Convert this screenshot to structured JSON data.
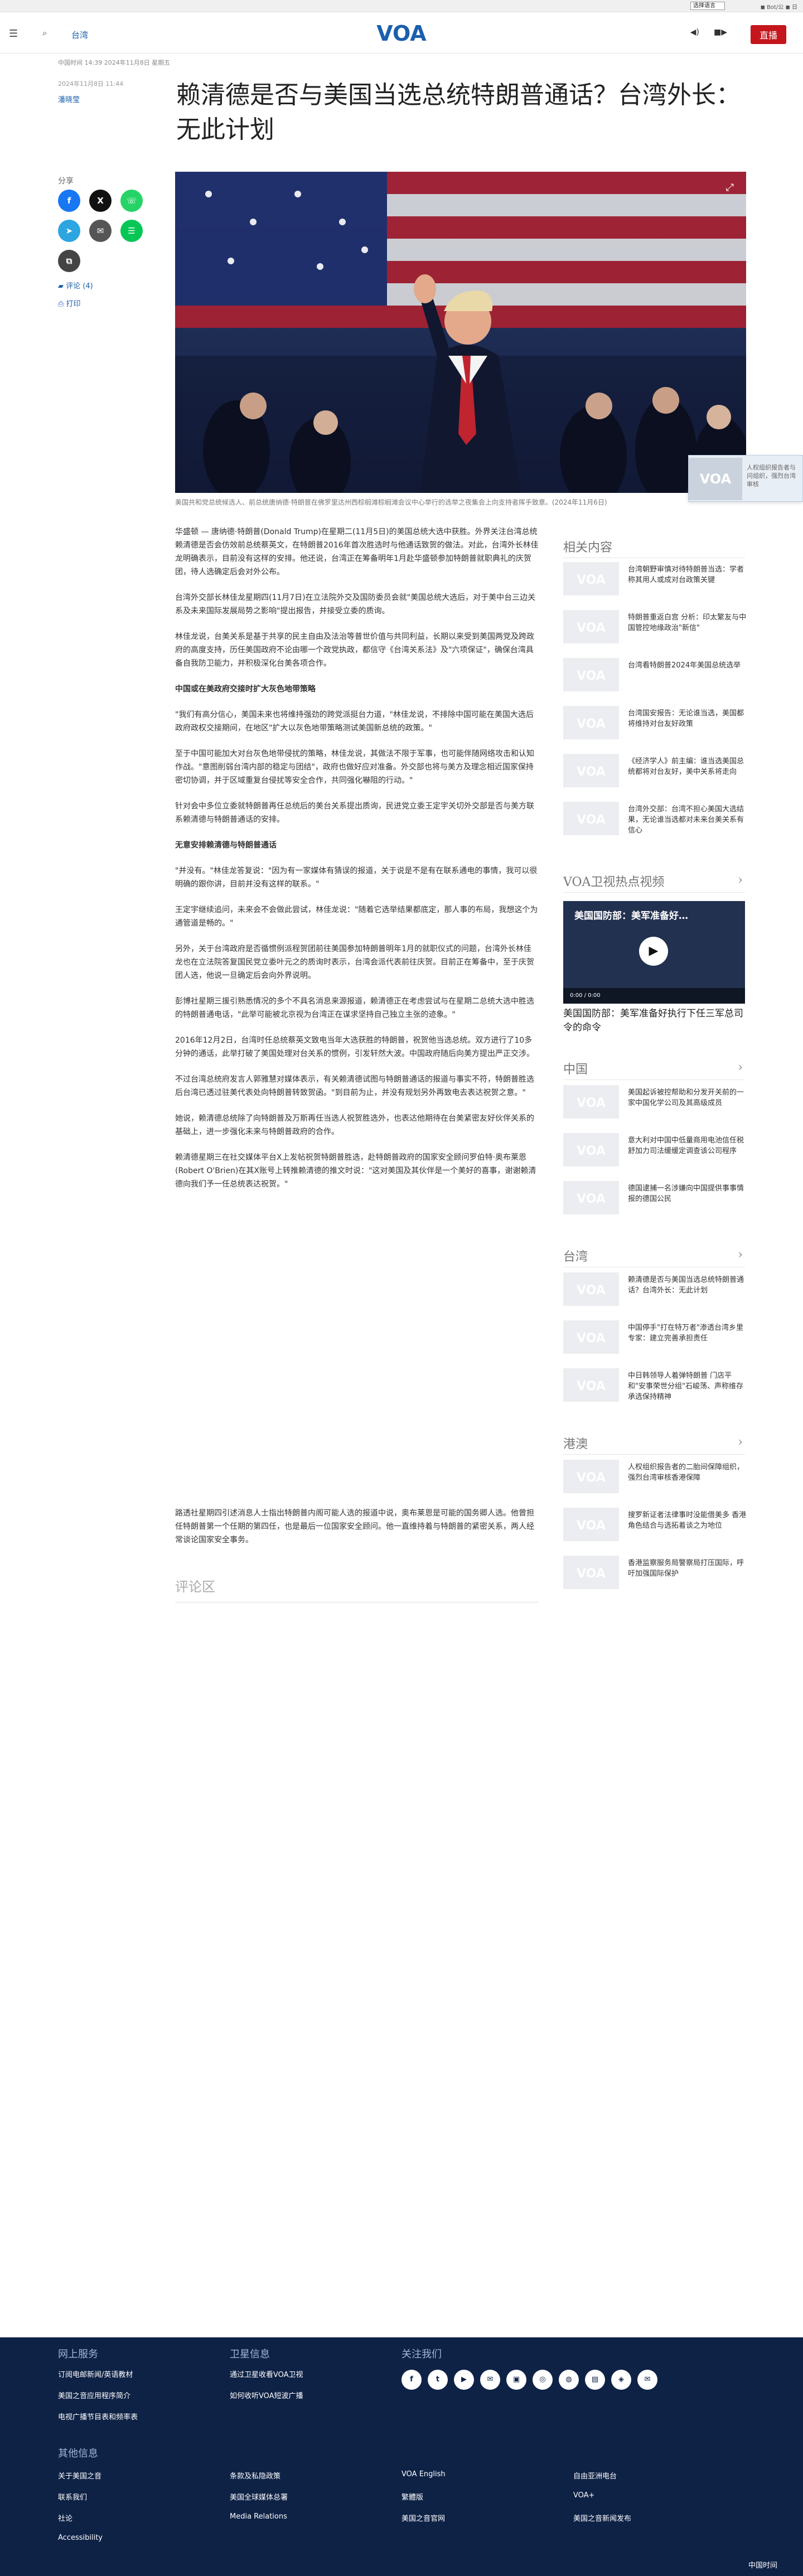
{
  "topbar": {
    "language_select": "选择语言",
    "links": "◼ Bot/公 ◼ 日"
  },
  "header": {
    "section": "台湾",
    "live_label": "直播"
  },
  "article": {
    "dateline": "中国时间 14:39 2024年11月8日 星期五",
    "published": "2024年11月8日 11:44",
    "author": "潘晓莹",
    "title": "赖清德是否与美国当选总统特朗普通话？台湾外长：无此计划",
    "share_label": "分享",
    "comments": "评论 (4)",
    "print": "打印",
    "caption": "美国共和党总统候选人、前总统唐纳德·特朗普在佛罗里达州西棕榈滩棕榈滩会议中心举行的选举之夜集会上向支持者挥手致意。(2024年11月6日)",
    "paragraphs": [
      {
        "type": "p",
        "text": "华盛顿 — 唐纳德·特朗普(Donald Trump)在星期二(11月5日)的美国总统大选中获胜。外界关注台湾总统赖清德是否会仿效前总统蔡英文，在特朗普2016年首次胜选时与他通话致贺的做法。对此，台湾外长林佳龙明确表示，目前没有这样的安排。他还说，台湾正在筹备明年1月赴华盛顿参加特朗普就职典礼的庆贺团，待人选确定后会对外公布。"
      },
      {
        "type": "p",
        "text": "台湾外交部长林佳龙星期四(11月7日)在立法院外交及国防委员会就\"美国总统大选后，对于美中台三边关系及未来国际发展局势之影响\"提出报告，并接受立委的质询。"
      },
      {
        "type": "p",
        "text": "林佳龙说，台美关系是基于共享的民主自由及法治等普世价值与共同利益，长期以来受到美国两党及跨政府的高度支持，历任美国政府不论由哪一个政党执政，都信守《台湾关系法》及\"六项保证\"，确保台湾具备自我防卫能力，并积极深化台美各项合作。"
      },
      {
        "type": "h3",
        "text": "中国或在美政府交接时扩大灰色地带策略"
      },
      {
        "type": "p",
        "text": "\"我们有高分信心，美国未来也将维持强劲的跨党派挺台力道，\"林佳龙说，不排除中国可能在美国大选后政府政权交接期间，在地区\"扩大以灰色地带策略测试美国新总统的政策。\""
      },
      {
        "type": "p",
        "text": "至于中国可能加大对台灰色地带侵扰的策略，林佳龙说，其做法不限于军事，也可能伴随网络攻击和认知作战。\"意图削弱台湾内部的稳定与团结\"，政府也做好应对准备。外交部也将与美方及理念相近国家保持密切协调，并于区域重复台侵扰等安全合作，共同强化嚇阻的行动。\""
      },
      {
        "type": "p",
        "text": "针对会中多位立委就特朗普再任总统后的美台关系提出质询，民进党立委王定宇关切外交部是否与美方联系赖清德与特朗普通话的安排。"
      },
      {
        "type": "h3",
        "text": "无意安排赖清德与特朗普通话"
      },
      {
        "type": "p",
        "text": "\"并没有。\"林佳龙答复说：\"因为有一家媒体有猜误的报道，关于说是不是有在联系通电的事情，我可以很明确的跟你讲，目前并没有这样的联系。\""
      },
      {
        "type": "p",
        "text": "王定宇继续追问，未来会不会做此尝试，林佳龙说：\"随着它选举结果都底定，那人事的布局，我想这个为通管道是畅的。\""
      },
      {
        "type": "p",
        "text": "另外，关于台湾政府是否循惯例派程贺团前往美国参加特朗普明年1月的就职仪式的问题，台湾外长林佳龙也在立法院答复国民党立委叶元之的质询时表示，台湾会派代表前往庆贺。目前正在筹备中，至于庆贺团人选，他说一旦确定后会向外界说明。"
      },
      {
        "type": "p",
        "text": "彭博社星期三援引熟悉情况的多个不具名消息来源报道，赖清德正在考虑尝试与在星期二总统大选中胜选的特朗普通电话，\"此举可能被北京视为台湾正在谋求坚持自己独立主张的迹象。\""
      },
      {
        "type": "p",
        "text": "2016年12月2日，台湾时任总统蔡英文致电当年大选获胜的特朗普，祝贺他当选总统。双方进行了10多分钟的通话，此举打破了美国处理对台关系的惯例，引发轩然大波。中国政府随后向美方提出严正交涉。"
      },
      {
        "type": "p",
        "text": "不过台湾总统府发言人郭雅慧对媒体表示，有关赖清德试图与特朗普通话的报道与事实不符，特朗普胜选后台湾已透过驻美代表处向特朗普转致贺函。\"到目前为止，并没有规划另外再致电去表达祝贺之意。\""
      },
      {
        "type": "p",
        "text": "她说，赖清德总统除了向特朗普及万斯再任当选人祝贺胜选外，也表达他期待在台美紧密友好伙伴关系的基础上，进一步强化未来与特朗普政府的合作。"
      },
      {
        "type": "p",
        "text": "赖清德星期三在社交媒体平台X上发帖祝贺特朗普胜选，赴特朗普政府的国家安全顾问罗伯特·奥布莱恩(Robert O'Brien)在其X账号上转推赖清德的推文时说：\"这对美国及其伙伴是一个美好的喜事，谢谢赖清德向我们予一任总统表达祝贺。\""
      }
    ],
    "endnote": "路透社星期四引述消息人士指出特朗普内阁可能人选的报道中说，奥布莱恩是可能的国务卿人选。他曾担任特朗普第一个任期的第四任，也是最后一位国家安全顾问。他一直维持着与特朗普的紧密关系，两人经常谈论国家安全事务。",
    "comment_zone": "评论区"
  },
  "floating_card": {
    "text": "人权组织报告者与问组织，强烈台湾审核"
  },
  "sidebar": {
    "related_title": "相关内容",
    "related": [
      "台湾朝野审慎对待特朗普当选：学者称其用人或成对台政策关键",
      "特朗普重返白宫 分析：印太繁友与中国管控地缘政治\"新信\"",
      "台湾看特朗普2024年美国总统选举",
      "台湾国安报告：无论谁当选，美国都将维持对台友好政策",
      "《经济学人》前主编：谁当选美国总统都将对台友好，美中关系将走向",
      "台湾外交部：台湾不担心美国大选结果，无论谁当选都对未来台美关系有信心"
    ],
    "video_title": "VOA卫视热点视频",
    "video_overlay": "美国国防部：美军准备好…",
    "video_time": "0:00 / 0:00",
    "video_caption": "美国国防部：美军准备好执行下任三军总司令的命令",
    "china_title": "中国",
    "china": [
      "美国起诉被控帮助和分发开关前的一家中国化学公司及其高级成员",
      "意大利对中国中低量商用电池信任税舒加力司法缓缓定调查该公司程序",
      "德国逮捕一名涉嫌向中国提供事事情报的德国公民"
    ],
    "taiwan_title": "台湾",
    "taiwan": [
      "赖清德是否与美国当选总统特朗普通话？台湾外长：无此计划",
      "中国停手\"打在特万者\"渗透台湾乡里 专家：建立完善承担责任",
      "中日韩领导人着弹特朗普 门店平和\"安事荣世分组\"石峻荡、声称维存承选保持精神"
    ],
    "hk_title": "港澳",
    "hk": [
      "人权组织报告者的二胎间保障组织，强烈台湾审核香港保障",
      "搜罗新证者法律事时没能借美多 香港角色结合与选拓着谈之为地位",
      "香港监察服务局警察局打压国际，呼吁加强国际保护"
    ]
  },
  "footer": {
    "col1_title": "网上服务",
    "col1": [
      "订阅电邮新闻/英语教材",
      "美国之音应用程序简介",
      "电视广播节目表和频率表"
    ],
    "col2_title": "卫星信息",
    "col2": [
      "通过卫星收看VOA卫视",
      "如何收听VOA短波广播"
    ],
    "col3_title": "关注我们",
    "social": [
      "f",
      "t",
      "▶",
      "✉",
      "▣",
      "◎",
      "◍",
      "▤",
      "◈",
      "✉"
    ],
    "col4_title": "其他信息",
    "info": [
      "关于美国之音",
      "条款及私隐政策",
      "VOA English",
      "自由亚洲电台",
      "联系我们",
      "美国全球媒体总署",
      "繁體版",
      "VOA+",
      "社论",
      "Media Relations",
      "美国之音官网",
      "美国之音新闻发布",
      "Accessibility"
    ],
    "language": "中国时间"
  }
}
